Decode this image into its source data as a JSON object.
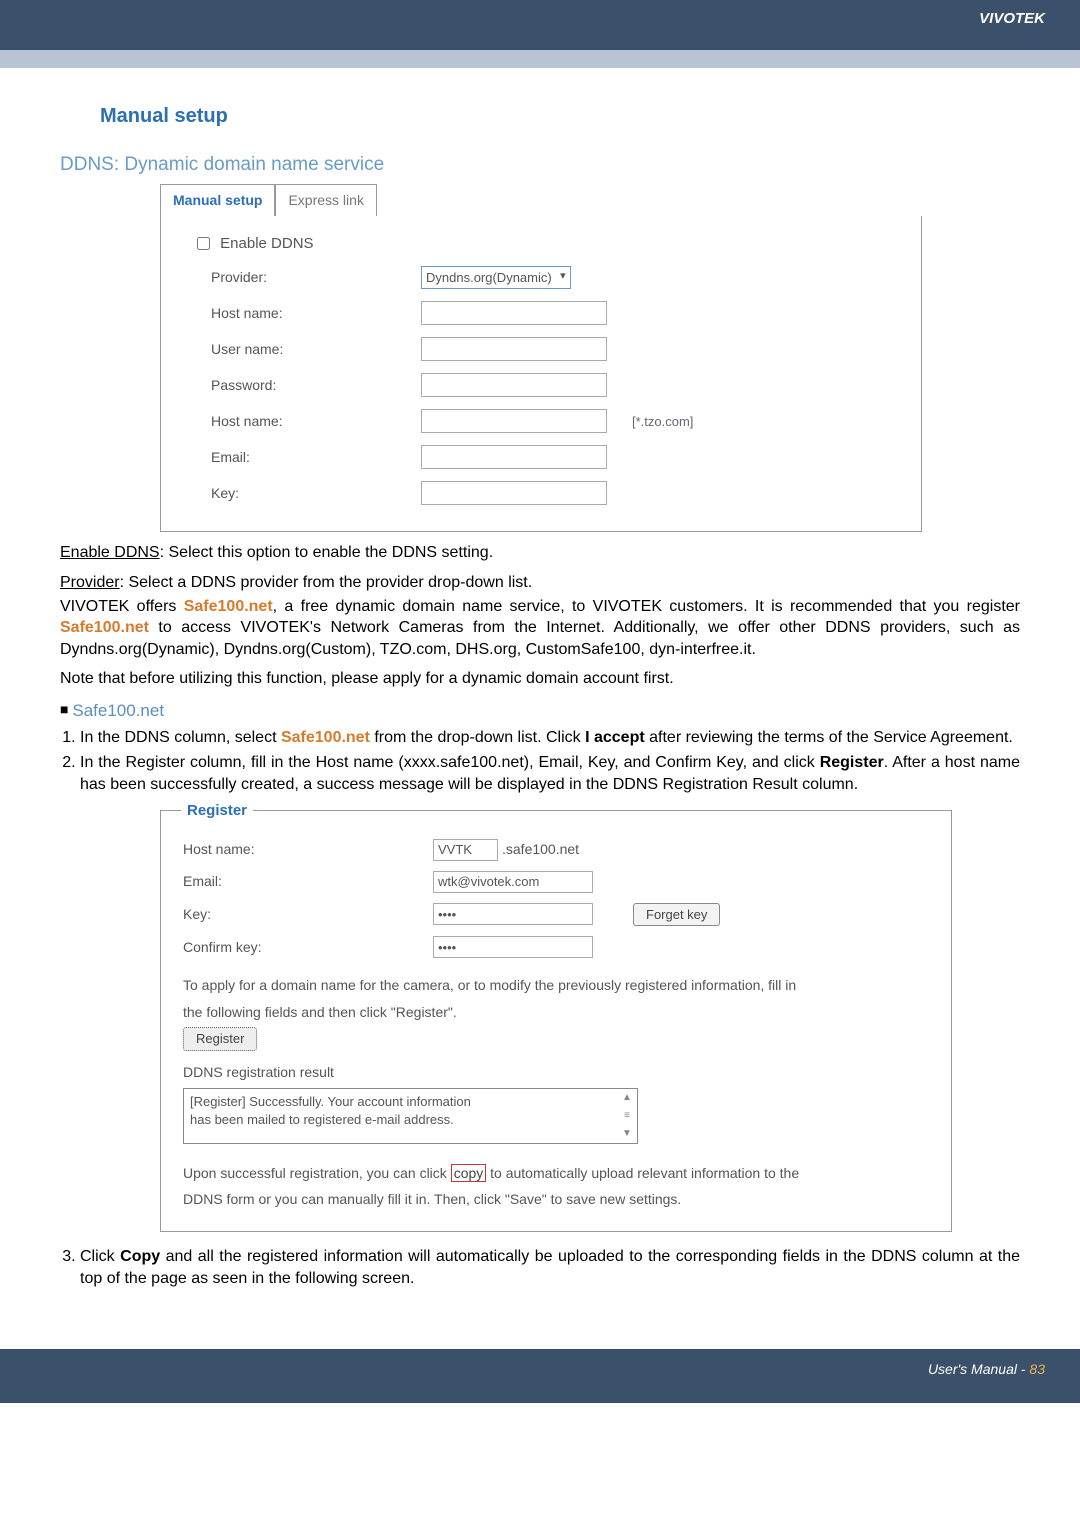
{
  "brand": "VIVOTEK",
  "heading_manual": "Manual setup",
  "heading_sub": "DDNS: Dynamic domain name service",
  "tabs": {
    "manual": "Manual setup",
    "express": "Express link"
  },
  "ddns_form": {
    "enable_label": "Enable DDNS",
    "provider_label": "Provider:",
    "provider_value": "Dyndns.org(Dynamic)",
    "host1_label": "Host name:",
    "user_label": "User name:",
    "pass_label": "Password:",
    "host2_label": "Host name:",
    "host2_suffix": "[*.tzo.com]",
    "email_label": "Email:",
    "key_label": "Key:"
  },
  "para1_a": "Enable DDNS",
  "para1_b": ": Select this option to enable the DDNS setting.",
  "para2_a": "Provider",
  "para2_b": ": Select a DDNS provider from the provider drop-down list.",
  "para3_pre": "VIVOTEK offers ",
  "para3_safe1": "Safe100.net",
  "para3_mid1": ", a free dynamic domain name service, to VIVOTEK customers. It is recommended that you register ",
  "para3_safe2": "Safe100.net",
  "para3_mid2": " to access VIVOTEK's Network Cameras from the Internet. Additionally, we offer other DDNS providers, such as Dyndns.org(Dynamic), Dyndns.org(Custom), TZO.com, DHS.org, CustomSafe100, dyn-interfree.it.",
  "para4": "Note that before utilizing this function, please apply for a dynamic domain account first.",
  "bullet_head": "Safe100.net",
  "step1_a": "In the DDNS column, select ",
  "step1_safe": "Safe100.net",
  "step1_b": " from the drop-down list. Click ",
  "step1_accept": "I accept",
  "step1_c": " after reviewing the terms of the Service Agreement.",
  "step2_a": "In the Register column, fill in the Host name (xxxx.safe100.net), Email, Key, and Confirm Key, and click ",
  "step2_reg": "Register",
  "step2_b": ". After a host name has been successfully created, a success message will be displayed in the DDNS Registration Result column.",
  "register": {
    "legend": "Register",
    "host_label": "Host name:",
    "host_value": "VVTK",
    "host_suffix": ".safe100.net",
    "email_label": "Email:",
    "email_value": "wtk@vivotek.com",
    "key_label": "Key:",
    "key_value": "••••",
    "forget_btn": "Forget key",
    "confirm_label": "Confirm key:",
    "confirm_value": "••••",
    "apply_line1": "To apply for a domain name for the camera, or to modify the previously registered information, fill in",
    "apply_line2": "the following fields and then click \"Register\".",
    "reg_btn": "Register",
    "result_head": "DDNS registration result",
    "result_text1": "[Register] Successfully. Your account information",
    "result_text2": "has been mailed to registered e-mail address.",
    "upon_a": "Upon successful registration, you can click ",
    "upon_copy": "copy",
    "upon_b": " to automatically upload relevant information to the",
    "upon_line2": "DDNS form or you can manually fill it in. Then, click \"Save\" to save new settings."
  },
  "step3_a": "Click ",
  "step3_copy": "Copy",
  "step3_b": " and all the registered information will automatically be uploaded to the corresponding fields in the DDNS column at the top of the page as seen in the following screen.",
  "footer_text": "User's Manual - ",
  "footer_page": "83"
}
